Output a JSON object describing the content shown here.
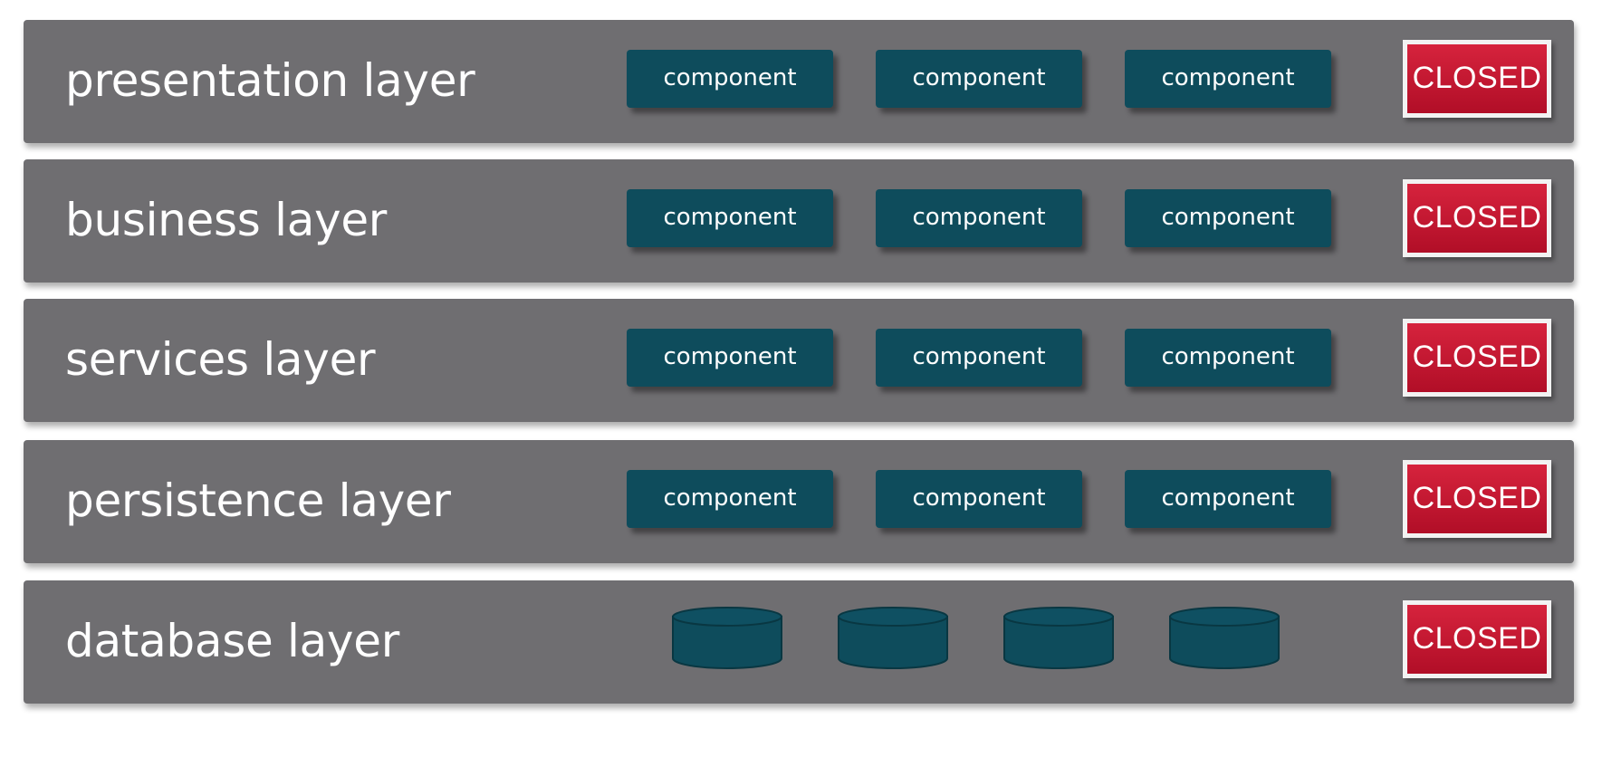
{
  "colors": {
    "layer_bg": "#6f6e71",
    "component_bg": "#0e4c5c",
    "closed_bg": "#c8172f",
    "text": "#ffffff"
  },
  "layers": [
    {
      "label": "presentation layer",
      "components": [
        "component",
        "component",
        "component"
      ],
      "status": "CLOSED"
    },
    {
      "label": "business layer",
      "components": [
        "component",
        "component",
        "component"
      ],
      "status": "CLOSED"
    },
    {
      "label": "services layer",
      "components": [
        "component",
        "component",
        "component"
      ],
      "status": "CLOSED"
    },
    {
      "label": "persistence layer",
      "components": [
        "component",
        "component",
        "component"
      ],
      "status": "CLOSED"
    },
    {
      "label": "database layer",
      "databases": [
        "database-icon",
        "database-icon",
        "database-icon",
        "database-icon"
      ],
      "status": "CLOSED"
    }
  ]
}
